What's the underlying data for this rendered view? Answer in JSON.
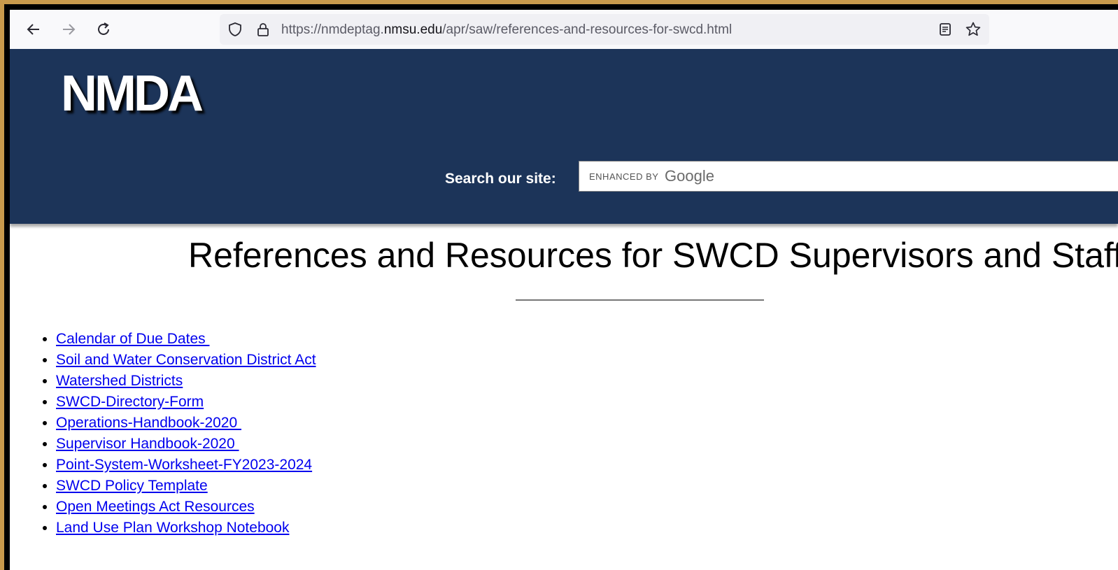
{
  "browser": {
    "url_prefix": "https://nmdeptag.",
    "url_host": "nmsu.edu",
    "url_path": "/apr/saw/references-and-resources-for-swcd.html"
  },
  "header": {
    "logo_text": "NMDA",
    "search_label": "Search our site:",
    "search_enhanced": "ENHANCED BY",
    "search_brand": "Google"
  },
  "main": {
    "title": "References and Resources for SWCD Supervisors and Staff",
    "links": [
      "Calendar of Due Dates ",
      "Soil and Water Conservation District Act",
      "Watershed Districts",
      "SWCD-Directory-Form",
      "Operations-Handbook-2020 ",
      "Supervisor Handbook-2020 ",
      "Point-System-Worksheet-FY2023-2024",
      "SWCD Policy Template",
      "Open Meetings Act Resources",
      "Land Use Plan Workshop Notebook"
    ]
  },
  "colors": {
    "header_bg": "#1c3459",
    "link": "#0000ee"
  }
}
